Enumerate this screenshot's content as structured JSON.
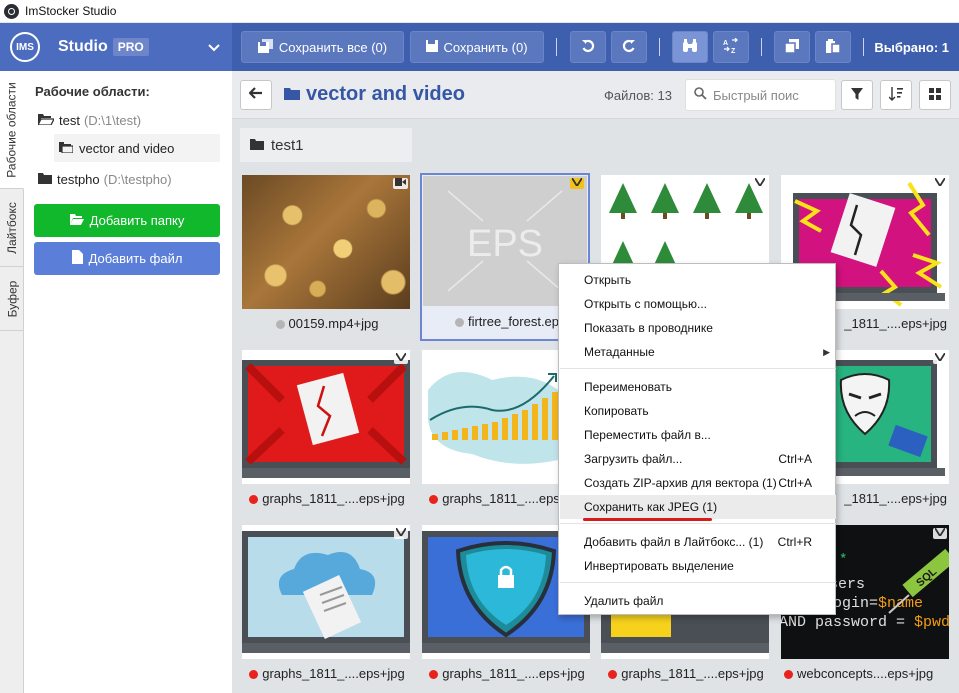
{
  "window": {
    "title": "ImStocker Studio"
  },
  "brand": {
    "logo": "IMS",
    "name": "Studio",
    "badge": "PRO"
  },
  "toolbar": {
    "save_all": "Сохранить все (0)",
    "save": "Сохранить (0)",
    "selected": "Выбрано: 1"
  },
  "vtabs": [
    "Рабочие области",
    "Лайтбокс",
    "Буфер"
  ],
  "sidebar": {
    "title": "Рабочие области:",
    "items": [
      {
        "name": "test",
        "path": "(D:\\1\\test)"
      },
      {
        "name": "vector and video"
      },
      {
        "name": "testpho",
        "path": "(D:\\testpho)"
      }
    ],
    "add_folder": "Добавить папку",
    "add_file": "Добавить файл"
  },
  "content": {
    "folder_title": "vector and video",
    "files_count": "Файлов: 13",
    "search_placeholder": "Быстрый поис",
    "group_label": "test1"
  },
  "tiles": [
    {
      "caption": "00159.mp4+jpg",
      "status": "grey"
    },
    {
      "caption": "firtree_forest.ep",
      "status": "grey",
      "thumb_text": "EPS"
    },
    {
      "caption": ""
    },
    {
      "caption": "_1811_....eps+jpg"
    },
    {
      "caption": "graphs_1811_....eps+jpg",
      "status": "red"
    },
    {
      "caption": "graphs_1811_....eps+jpg",
      "status": "red"
    },
    {
      "caption": ""
    },
    {
      "caption": "_1811_....eps+jpg"
    },
    {
      "caption": "graphs_1811_....eps+jpg",
      "status": "red"
    },
    {
      "caption": "graphs_1811_....eps+jpg",
      "status": "red"
    },
    {
      "caption": "graphs_1811_....eps+jpg",
      "status": "red"
    },
    {
      "caption": "webconcepts....eps+jpg",
      "status": "red"
    }
  ],
  "sql_thumb": {
    "l1": "sers",
    "l2a": "ogin=",
    "l2b": "$name",
    "l3a": "AND password = ",
    "l3b": "$pwd\"",
    "tag": "SQL"
  },
  "context_menu": [
    {
      "label": "Открыть"
    },
    {
      "label": "Открыть с помощью..."
    },
    {
      "label": "Показать в проводнике"
    },
    {
      "label": "Метаданные",
      "submenu": true
    },
    {
      "label": "Переименовать"
    },
    {
      "label": "Копировать"
    },
    {
      "label": "Переместить файл в..."
    },
    {
      "label": "Загрузить файл...",
      "shortcut": "Ctrl+A"
    },
    {
      "label": "Создать ZIP-архив для вектора (1)",
      "shortcut": "Ctrl+A"
    },
    {
      "label": "Сохранить как JPEG (1)",
      "highlighted": true
    },
    {
      "label": "Добавить файл в Лайтбокс... (1)",
      "shortcut": "Ctrl+R"
    },
    {
      "label": "Инвертировать выделение"
    },
    {
      "label": "Удалить файл"
    }
  ],
  "colors": {
    "header": "#3e5fae",
    "brand_bg": "#4c6cc0",
    "green_btn": "#11b82c",
    "blue_btn": "#5b7fd8",
    "status_red": "#e8231b",
    "status_grey": "#b5b5b5",
    "folder_title": "#3657a6"
  }
}
